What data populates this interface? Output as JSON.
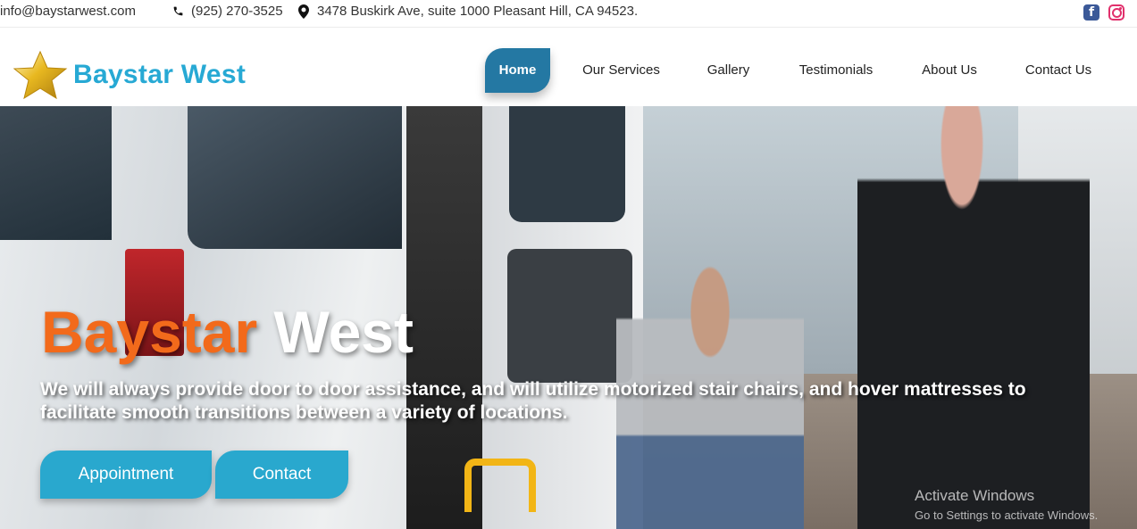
{
  "topbar": {
    "email": "info@baystarwest.com",
    "phone": "(925) 270-3525",
    "address": "3478 Buskirk Ave, suite 1000 Pleasant Hill, CA 94523.",
    "icons": {
      "phone": "phone-icon",
      "location": "map-marker-icon",
      "facebook": "facebook-icon",
      "instagram": "instagram-icon"
    },
    "colors": {
      "facebook": "#3b5998",
      "instagram": "#e1306c"
    }
  },
  "header": {
    "logo_text": "Baystar West",
    "logo_color": "#27a9d4",
    "nav": [
      {
        "label": "Home",
        "active": true
      },
      {
        "label": "Our Services",
        "active": false
      },
      {
        "label": "Gallery",
        "active": false
      },
      {
        "label": "Testimonials",
        "active": false
      },
      {
        "label": "About Us",
        "active": false
      },
      {
        "label": "Contact Us",
        "active": false
      }
    ],
    "active_color": "#2478a3"
  },
  "hero": {
    "title_part1": "Baystar",
    "title_part2": "West",
    "title_color1": "#f26a1b",
    "subtitle": "We will always provide door to door assistance, and will utilize motorized stair chairs, and hover mattresses to facilitate smooth transitions between a variety of locations.",
    "buttons": {
      "appointment": "Appointment",
      "contact": "Contact"
    },
    "button_color": "#29a8ce"
  },
  "watermark": {
    "line1": "Activate Windows",
    "line2": "Go to Settings to activate Windows."
  }
}
